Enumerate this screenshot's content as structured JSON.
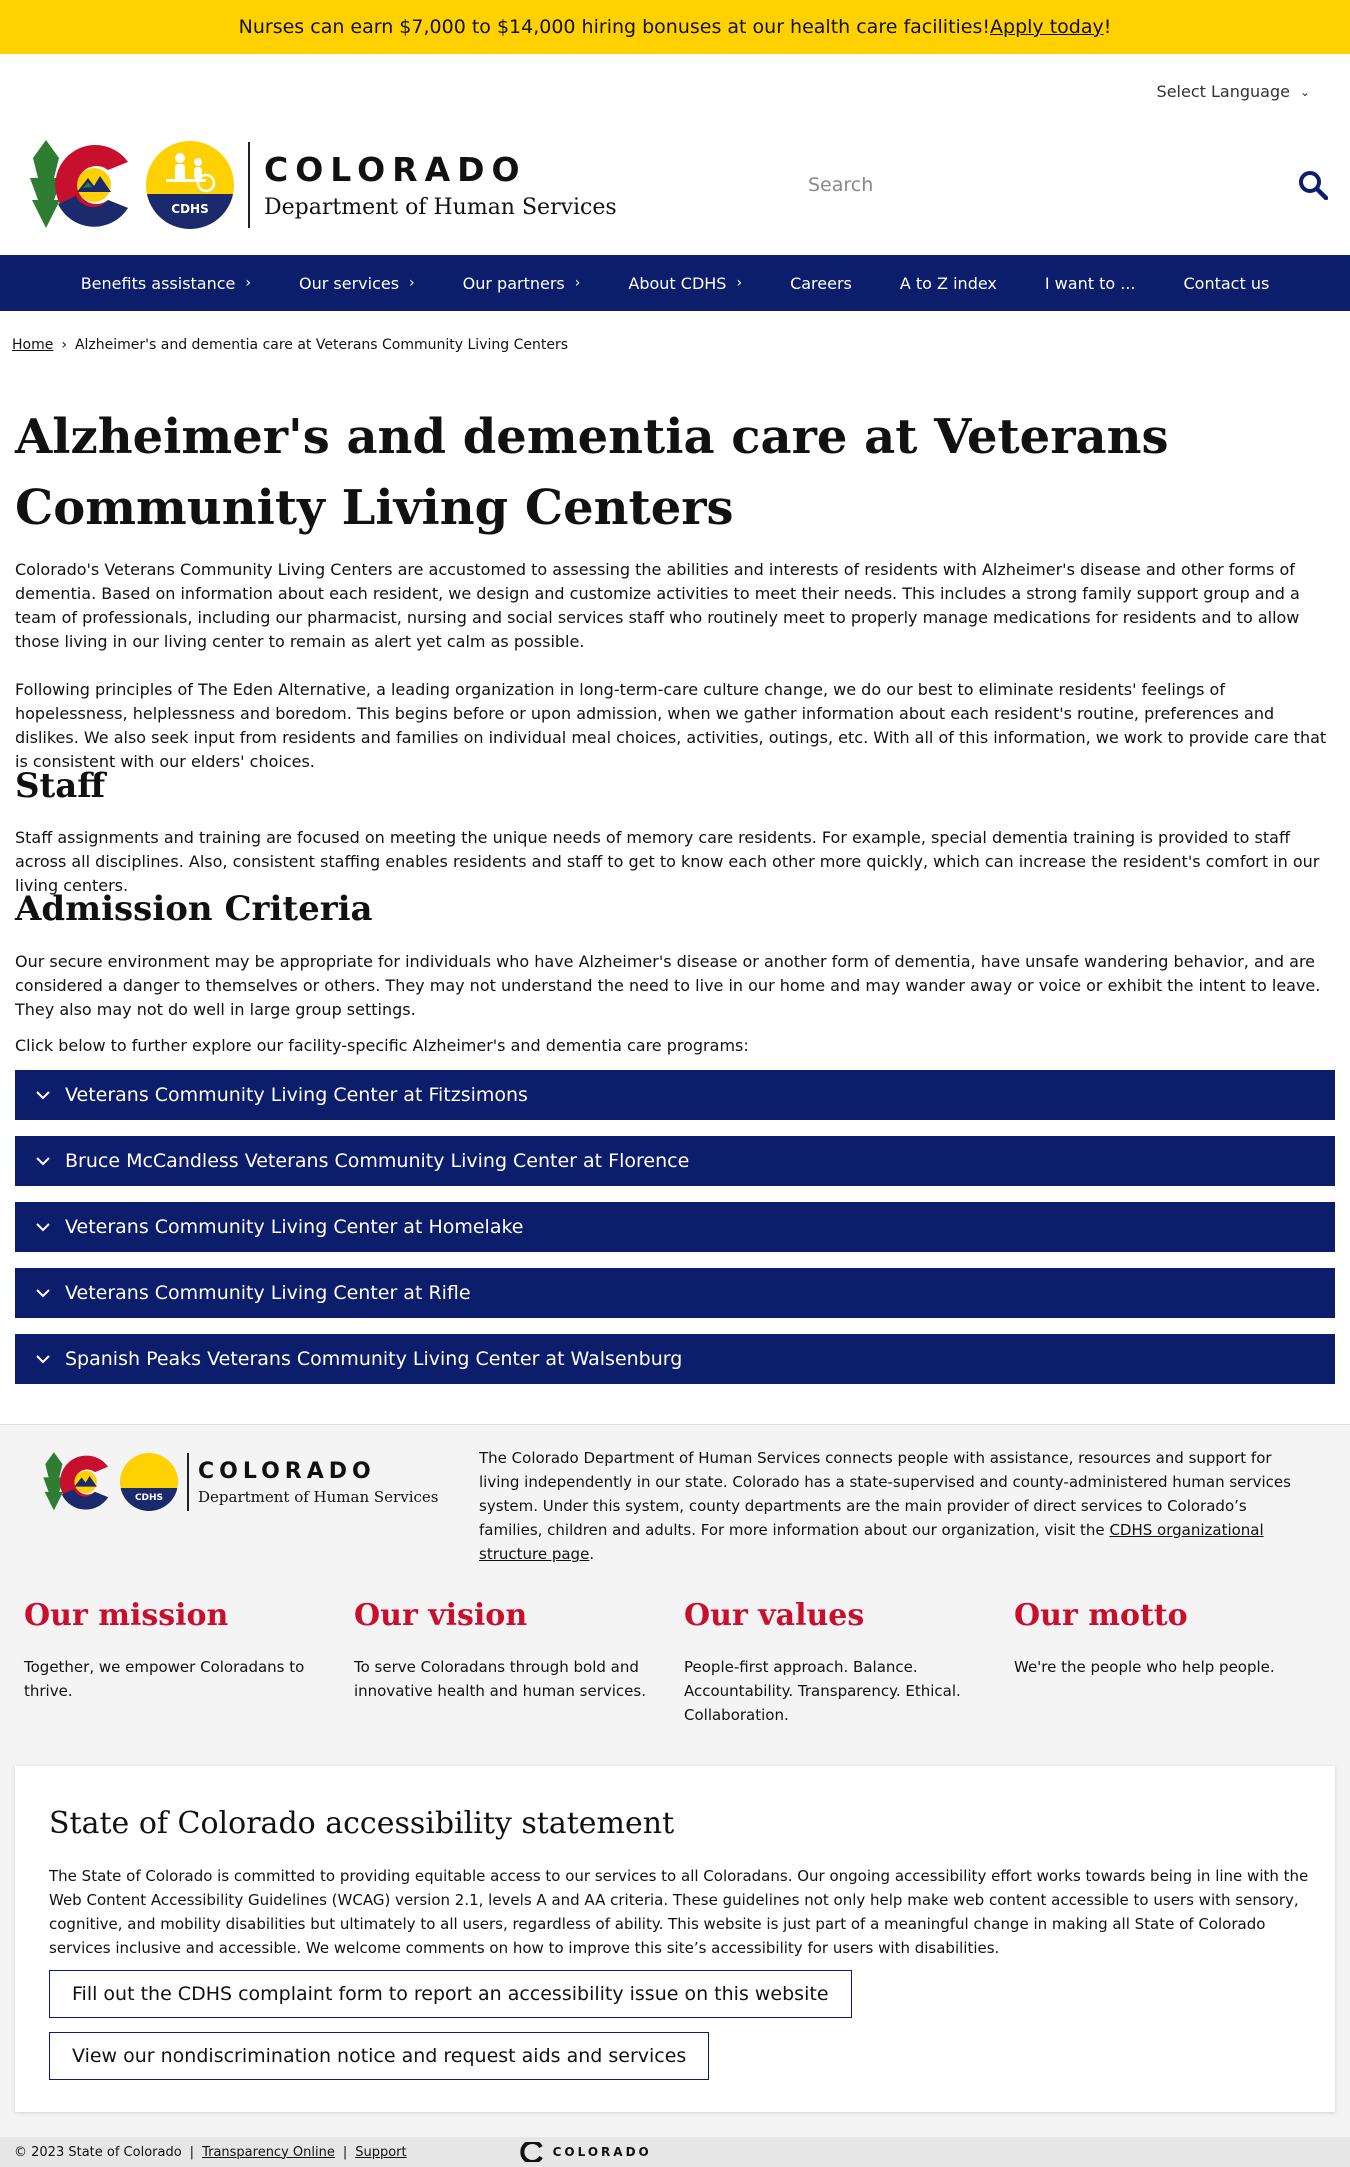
{
  "banner": {
    "text_before": "Nurses can earn $7,000 to $14,000 hiring bonuses at our health care facilities! ",
    "link": "Apply today",
    "text_after": "!"
  },
  "header": {
    "language_label": "Select Language",
    "logo_state": "COLORADO",
    "logo_dept": "Department of Human Services",
    "logo_badge": "CDHS",
    "search_placeholder": "Search"
  },
  "nav": {
    "items": [
      {
        "label": "Benefits assistance",
        "has_submenu": true
      },
      {
        "label": "Our services",
        "has_submenu": true
      },
      {
        "label": "Our partners",
        "has_submenu": true
      },
      {
        "label": "About CDHS",
        "has_submenu": true
      },
      {
        "label": "Careers",
        "has_submenu": false
      },
      {
        "label": "A to Z index",
        "has_submenu": false
      },
      {
        "label": "I want to ...",
        "has_submenu": false
      },
      {
        "label": "Contact us",
        "has_submenu": false
      }
    ]
  },
  "breadcrumb": {
    "home": "Home",
    "separator": "›",
    "current": "Alzheimer's and dementia care at Veterans Community Living Centers"
  },
  "main": {
    "title": "Alzheimer's and dementia care at Veterans Community Living Centers",
    "intro_p1": "Colorado's Veterans Community Living Centers are accustomed to assessing the abilities and interests of residents with Alzheimer's disease and other forms of dementia. Based on information about each resident, we design and customize activities to meet their needs. This includes a strong family support group and a team of professionals, including our pharmacist, nursing and social services staff who routinely meet to properly manage medications for residents and to allow those living in our living center to remain as alert yet calm as possible.",
    "intro_p2": "Following principles of The Eden Alternative, a leading organization in long-term-care culture change, we do our best to eliminate residents' feelings of hopelessness, helplessness and boredom. This begins before or upon admission, when we gather information about each resident's routine, preferences and dislikes. We also seek input from residents and families on individual meal choices, activities, outings, etc. With all of this information, we work to provide care that is consistent with our elders' choices.",
    "staff_heading": "Staff",
    "staff_p": "Staff assignments and training are focused on meeting the unique needs of memory care residents. For example, special dementia training is provided to staff across all disciplines. Also, consistent staffing enables residents and staff to get to know each other more quickly, which can increase the resident's comfort in our living centers.",
    "admission_heading": "Admission Criteria",
    "admission_p": "Our secure environment may be appropriate for individuals who have Alzheimer's disease or another form of dementia, have unsafe wandering behavior, and are considered a danger to themselves or others. They may not understand the need to live in our home and may wander away or voice or exhibit the intent to leave. They also may not do well in large group settings.",
    "explore_p": "Click below to further explore our facility-specific Alzheimer's and dementia care programs:",
    "accordions": [
      "Veterans Community Living Center at Fitzsimons",
      "Bruce McCandless Veterans Community Living Center at Florence",
      "Veterans Community Living Center at Homelake",
      "Veterans Community Living Center at Rifle",
      "Spanish Peaks Veterans Community Living Center at Walsenburg"
    ]
  },
  "footer": {
    "logo_state": "COLORADO",
    "logo_dept": "Department of Human Services",
    "logo_badge": "CDHS",
    "desc": "The Colorado Department of Human Services connects people with assistance, resources and support for living independently in our state. Colorado has a state-supervised and county-administered human services system. Under this system, county departments are the main provider of direct services to Colorado’s families, children and adults. For more information about our organization, visit the ",
    "desc_link": "CDHS organizational structure page",
    "desc_end": ".",
    "columns": [
      {
        "heading": "Our mission",
        "text": "Together, we empower Coloradans to thrive."
      },
      {
        "heading": "Our vision",
        "text": "To serve Coloradans through bold and innovative health and human services."
      },
      {
        "heading": "Our values",
        "text": "People-first approach. Balance. Accountability. Transparency. Ethical. Collaboration."
      },
      {
        "heading": "Our motto",
        "text": "We're the people who help people."
      }
    ],
    "a11y": {
      "heading": "State of Colorado accessibility statement",
      "text": "The State of Colorado is committed to providing equitable access to our services to all Coloradans. Our ongoing accessibility effort works towards being in line with the Web Content Accessibility Guidelines (WCAG) version 2.1, levels A and AA criteria. These guidelines not only help make web content accessible to users with sensory, cognitive, and mobility disabilities but ultimately to all users, regardless of ability. This website is just part of a meaningful change in making all State of Colorado services inclusive and accessible. We welcome comments on how to improve this site’s accessibility for users with disabilities.",
      "button1": "Fill out the CDHS complaint form to report an accessibility issue on this website",
      "button2": "View our nondiscrimination notice and request aids and services"
    },
    "bottom": {
      "copyright": "© 2023 State of Colorado",
      "sep": "|",
      "link1": "Transparency Online",
      "link2": "Support",
      "logo": "COLORADO"
    }
  },
  "colors": {
    "banner_bg": "#ffd100",
    "nav_bg": "#0c1d6b",
    "accent_red": "#c8102e",
    "footer_bg": "#f4f4f4"
  }
}
